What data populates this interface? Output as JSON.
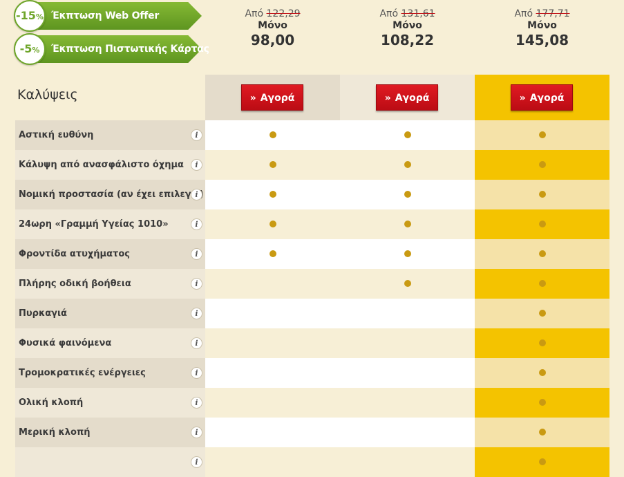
{
  "discounts": [
    {
      "percent": "-15",
      "unit": "%",
      "label": "Έκπτωση Web Offer"
    },
    {
      "percent": "-5",
      "unit": "%",
      "label": "Έκπτωση Πιστωτικής Κάρτας"
    }
  ],
  "plans": [
    {
      "from_label": "Από",
      "old_price": "122,29",
      "only_label": "Μόνο",
      "price": "98,00",
      "buy_label": "Αγορά"
    },
    {
      "from_label": "Από",
      "old_price": "131,61",
      "only_label": "Μόνο",
      "price": "108,22",
      "buy_label": "Αγορά"
    },
    {
      "from_label": "Από",
      "old_price": "177,71",
      "only_label": "Μόνο",
      "price": "145,08",
      "buy_label": "Αγορά"
    }
  ],
  "coverage_heading": "Καλύψεις",
  "info_symbol": "i",
  "buy_chevron": "»",
  "coverages": [
    {
      "label": "Αστική ευθύνη",
      "included": [
        true,
        true,
        true
      ]
    },
    {
      "label": "Κάλυψη από ανασφάλιστο όχημα",
      "included": [
        true,
        true,
        true
      ]
    },
    {
      "label": "Νομική προστασία (αν έχει επιλεγεί)",
      "included": [
        true,
        true,
        true
      ]
    },
    {
      "label": "24ωρη «Γραμμή Υγείας 1010»",
      "included": [
        true,
        true,
        true
      ]
    },
    {
      "label": "Φροντίδα ατυχήματος",
      "included": [
        true,
        true,
        true
      ]
    },
    {
      "label": "Πλήρης οδική βοήθεια",
      "included": [
        false,
        true,
        true
      ]
    },
    {
      "label": "Πυρκαγιά",
      "included": [
        false,
        false,
        true
      ]
    },
    {
      "label": "Φυσικά φαινόμενα",
      "included": [
        false,
        false,
        true
      ]
    },
    {
      "label": "Τρομοκρατικές ενέργειες",
      "included": [
        false,
        false,
        true
      ]
    },
    {
      "label": "Ολική κλοπή",
      "included": [
        false,
        false,
        true
      ]
    },
    {
      "label": "Μερική κλοπή",
      "included": [
        false,
        false,
        true
      ]
    },
    {
      "label": "",
      "included": [
        false,
        false,
        true
      ]
    }
  ],
  "colors": {
    "badge_green": "#6ea52a",
    "buy_red": "#d4121a",
    "dot": "#c99a12",
    "highlight_plan": "#f4c300",
    "highlight_plan_alt": "#f5e2a8"
  }
}
